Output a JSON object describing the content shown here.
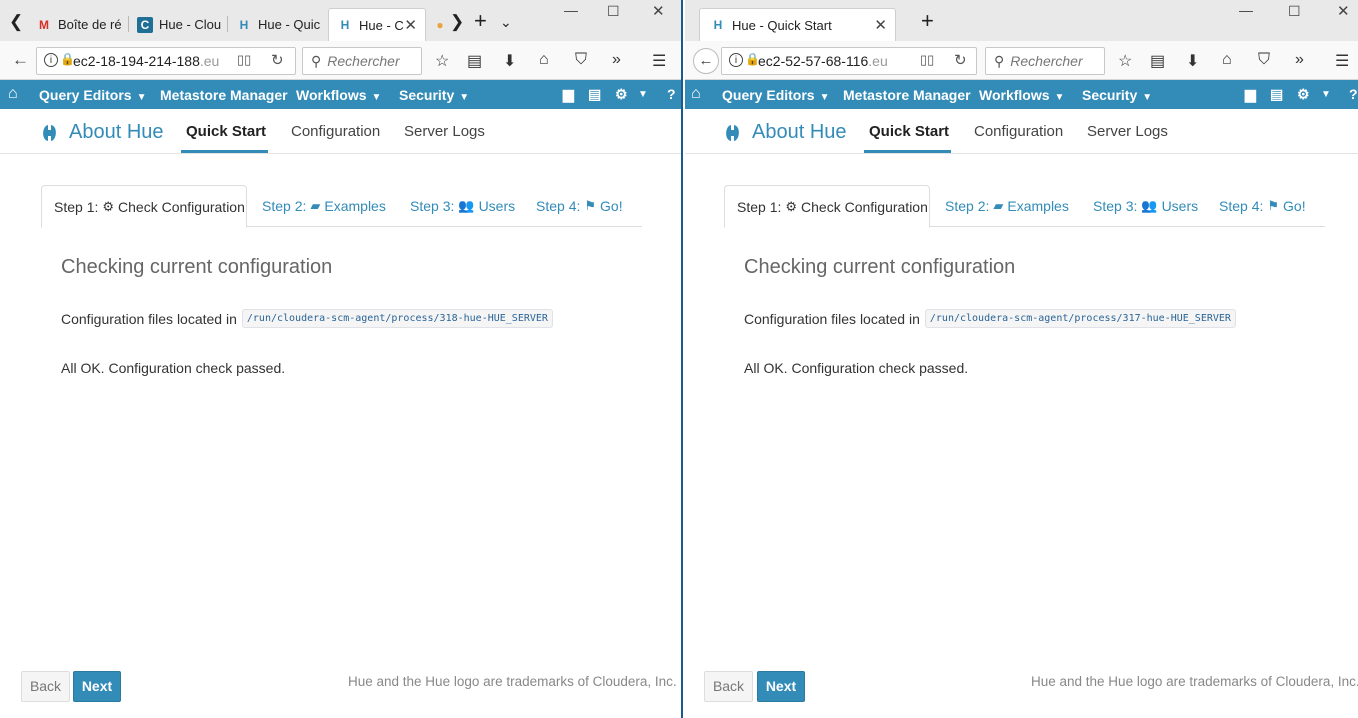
{
  "left": {
    "tabs": [
      {
        "title": "Boîte de ré",
        "icon": "gmail-icon"
      },
      {
        "title": "Hue - Clou",
        "icon": "cloudera-icon"
      },
      {
        "title": "Hue - Quic",
        "icon": "hue-icon"
      },
      {
        "title": "Hue - C",
        "icon": "hue-icon"
      }
    ],
    "url": "ec2-18-194-214-188",
    "url_fade": ".eu",
    "config_path": "/run/cloudera-scm-agent/process/318-hue-HUE_SERVER"
  },
  "right": {
    "tabs": [
      {
        "title": "Hue - Quick Start",
        "icon": "hue-icon"
      }
    ],
    "url": "ec2-52-57-68-116",
    "url_fade": ".eu",
    "config_path": "/run/cloudera-scm-agent/process/317-hue-HUE_SERVER"
  },
  "browser": {
    "search_placeholder": "Rechercher"
  },
  "hue": {
    "menu": {
      "query_editors": "Query Editors",
      "metastore": "Metastore Manager",
      "workflows": "Workflows",
      "security": "Security"
    },
    "subnav": {
      "logo": "About Hue",
      "tabs": [
        "Quick Start",
        "Configuration",
        "Server Logs"
      ]
    },
    "steps": [
      {
        "prefix": "Step 1:",
        "label": "Check Configuration",
        "icon": "cogs-icon"
      },
      {
        "prefix": "Step 2:",
        "label": "Examples",
        "icon": "book-icon"
      },
      {
        "prefix": "Step 3:",
        "label": "Users",
        "icon": "users-icon"
      },
      {
        "prefix": "Step 4:",
        "label": "Go!",
        "icon": "flag-icon"
      }
    ],
    "heading": "Checking current configuration",
    "config_label": "Configuration files located in",
    "ok_text": "All OK. Configuration check passed.",
    "back": "Back",
    "next": "Next",
    "footer": "Hue and the Hue logo are trademarks of Cloudera, Inc."
  },
  "colors": {
    "hue_blue": "#338bb8"
  }
}
